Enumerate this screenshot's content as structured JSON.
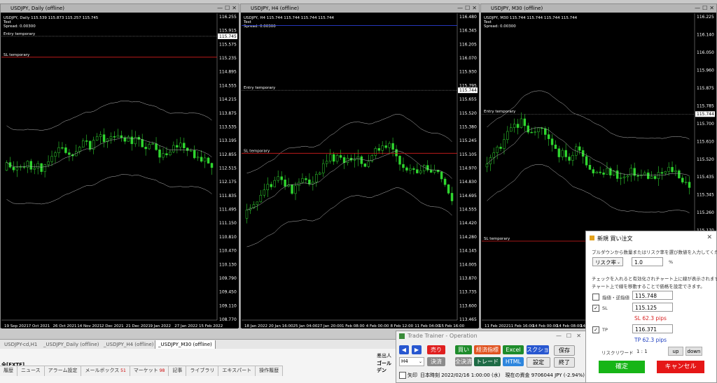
{
  "windows": [
    {
      "title": "USDJPY, Daily (offline)",
      "info": [
        "USDJPY, Daily  115.539 115.873 115.257 115.745",
        "Test",
        "Spread: 0.00300"
      ],
      "prices": [
        "116.255",
        "115.915",
        "115.575",
        "115.235",
        "114.895",
        "114.555",
        "114.215",
        "113.875",
        "113.535",
        "113.195",
        "112.855",
        "112.515",
        "112.175",
        "111.835",
        "111.495",
        "111.150",
        "110.810",
        "110.470",
        "110.130",
        "109.790",
        "109.450",
        "109.110",
        "108.770"
      ],
      "dates": [
        "19 Sep 2021",
        "7 Oct 2021",
        "26 Oct 2021",
        "14 Nov 2021",
        "2 Dec 2021",
        "21 Dec 2021",
        "9 Jan 2022",
        "27 Jan 2022",
        "15 Feb 2022"
      ],
      "entry_label": "Entry temporary",
      "sl_label": "SL temporary",
      "last_price": "115.745",
      "levels": {
        "top": 116.255,
        "bottom": 108.77,
        "entry": 115.745,
        "sl": 115.235,
        "blue": 116.35
      },
      "seed": 11
    },
    {
      "title": "USDJPY, H4 (offline)",
      "info": [
        "USDJPY, H4  115.744 115.744 115.744 115.744",
        "Test",
        "Spread: 0.00300"
      ],
      "prices": [
        "116.480",
        "116.345",
        "116.205",
        "116.070",
        "115.930",
        "115.795",
        "115.655",
        "115.520",
        "115.380",
        "115.245",
        "115.105",
        "114.970",
        "114.830",
        "114.695",
        "114.555",
        "114.420",
        "114.280",
        "114.145",
        "114.005",
        "113.870",
        "113.735",
        "113.600",
        "113.465"
      ],
      "dates": [
        "18 Jan 2022",
        "20 Jan 16:00",
        "25 Jan 04:00",
        "27 Jan 20:00",
        "1 Feb 08:00",
        "4 Feb 00:00",
        "8 Feb 12:00",
        "11 Feb 04:00",
        "15 Feb 16:00"
      ],
      "entry_label": "Entry temporary",
      "sl_label": "SL temporary",
      "last_price": "115.744",
      "levels": {
        "top": 116.48,
        "bottom": 113.465,
        "entry": 115.744,
        "sl": 115.125,
        "blue": 116.38
      },
      "seed": 23
    },
    {
      "title": "USDJPY, M30 (offline)",
      "info": [
        "USDJPY, M30  115.744 115.744 115.744 115.744",
        "Test",
        "Spread: 0.00300"
      ],
      "prices": [
        "116.225",
        "116.140",
        "116.050",
        "115.960",
        "115.875",
        "115.785",
        "115.700",
        "115.610",
        "115.520",
        "115.435",
        "115.345",
        "115.260",
        "115.170",
        "115.080",
        "114.995",
        "114.905",
        "114.820",
        "114.730"
      ],
      "dates": [
        "11 Feb 2022",
        "11 Feb 16:00",
        "14 Feb 00:00",
        "14 Feb 08:00",
        "14 Feb 16:00",
        "15 Feb 00:00",
        "15 Feb 08:00",
        "15 Feb 16:00",
        "16 Feb 00:00"
      ],
      "entry_label": "Entry temporary",
      "sl_label": "SL temporary",
      "last_price": "115.744",
      "levels": {
        "top": 116.225,
        "bottom": 114.73,
        "entry": 115.744,
        "sl": 115.125,
        "blue": 116.3
      },
      "seed": 37
    }
  ],
  "tabs": [
    "USDJPY-cd,H1",
    "_USDJPY_Daily (offline)",
    "_USDJPY_H4 (offline)",
    "_USDJPY_M30 (offline)"
  ],
  "bottom_tabs": [
    {
      "label": "履歴"
    },
    {
      "label": "ニュース"
    },
    {
      "label": "アラーム設定"
    },
    {
      "label": "メールボックス",
      "count": "51"
    },
    {
      "label": "マーケット",
      "count": "98"
    },
    {
      "label": "記事"
    },
    {
      "label": "ライブラリ"
    },
    {
      "label": "エキスパート"
    },
    {
      "label": "操作履歴"
    }
  ],
  "terminal": {
    "account": "全[FXTF]",
    "col1": "差出人",
    "col2": "ゴールデン"
  },
  "trade_trainer": {
    "title": "Trade Trainer - Operation",
    "prev": "◀",
    "next": "▶",
    "buttons_row1": [
      {
        "label": "売り",
        "color": "#e01f1f"
      },
      {
        "label": "買い",
        "color": "#1e8c2b"
      },
      {
        "label": "経済指標",
        "color": "#e0521f"
      },
      {
        "label": "Excel",
        "color": "#1e8c2b"
      },
      {
        "label": "スクショ",
        "color": "#2857d0"
      },
      {
        "label": "保存",
        "color": "#e6e6e6"
      }
    ],
    "buttons_row2": [
      {
        "label": "決済",
        "color": "#8c8c8c"
      },
      {
        "label": "全決済",
        "color": "#8c8c8c"
      },
      {
        "label": "トレード",
        "color": "#1e6b45"
      },
      {
        "label": "HTML",
        "color": "#2e86de"
      },
      {
        "label": "設定",
        "color": "#e6e6e6"
      },
      {
        "label": "終了",
        "color": "#e6e6e6"
      }
    ],
    "timeframe": "H4",
    "arrow_label": "矢印",
    "status": "日本時刻 2022/02/16 1:00:00 (水)　現在の資金 9706044 JPY (-2.94%)"
  },
  "order_dialog": {
    "title": "新規 買い注文",
    "instruction": "プルダウンから数量またはリスク率を選び数値を入力してください。",
    "mode_select": "リスク率",
    "mode_value": "1.0",
    "unit": "%",
    "note1": "チェックを入れると有効化されチャート上に線が表示されます。",
    "note2": "チャート上で線を移動することで価格を設定できます。",
    "limit_label": "指値・逆指値",
    "limit_value": "115.748",
    "sl_label": "SL",
    "sl_value": "115.125",
    "sl_pips": "SL 62.3 pips",
    "tp_label": "TP",
    "tp_value": "116.371",
    "tp_pips": "TP 62.3 pips",
    "risk_reward_label": "リスクリワード",
    "risk_reward_value": "1 : 1",
    "up": "up",
    "down": "down",
    "confirm": "確定",
    "cancel": "キャンセル",
    "colors": {
      "confirm": "#17b517",
      "cancel": "#e51717",
      "sl": "#d82020",
      "tp": "#2040c0"
    }
  }
}
